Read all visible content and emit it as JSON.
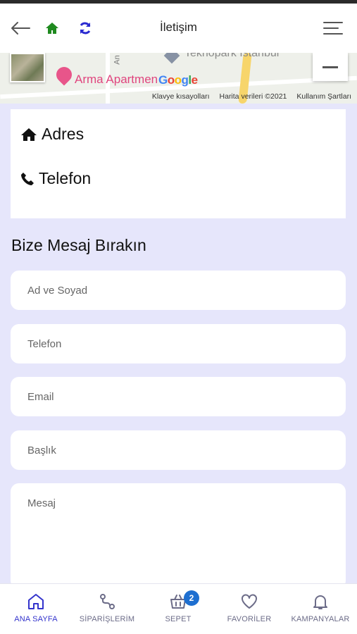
{
  "header": {
    "title": "İletişim",
    "icons": {
      "back": "arrow-left-icon",
      "home": "home-icon",
      "refresh": "refresh-icon",
      "menu": "menu-icon"
    }
  },
  "map": {
    "place_label": "Arma Apartmen",
    "google_logo": "Google",
    "landmark_label": "Teknopark İstanbul",
    "road_label": "An",
    "attribution": {
      "shortcuts": "Klavye kısayolları",
      "data": "Harita verileri ©2021",
      "terms": "Kullanım Şartları"
    }
  },
  "contact": {
    "address_label": "Adres",
    "phone_label": "Telefon"
  },
  "form": {
    "title": "Bize Mesaj Bırakın",
    "name_placeholder": "Ad ve Soyad",
    "phone_placeholder": "Telefon",
    "email_placeholder": "Email",
    "subject_placeholder": "Başlık",
    "message_placeholder": "Mesaj"
  },
  "tabbar": {
    "items": [
      {
        "label": "ANA SAYFA",
        "icon": "home-outline-icon",
        "active": true
      },
      {
        "label": "SİPARİŞLERİM",
        "icon": "route-icon",
        "active": false
      },
      {
        "label": "SEPET",
        "icon": "basket-icon",
        "active": false,
        "badge": "2"
      },
      {
        "label": "FAVORİLER",
        "icon": "heart-icon",
        "active": false
      },
      {
        "label": "KAMPANYALAR",
        "icon": "bell-icon",
        "active": false
      }
    ]
  },
  "colors": {
    "background": "#e6e6fb",
    "accent": "#3333cc",
    "home_green": "#1f8a1f",
    "refresh_blue": "#2a2ad0",
    "badge": "#1e6fd0"
  }
}
